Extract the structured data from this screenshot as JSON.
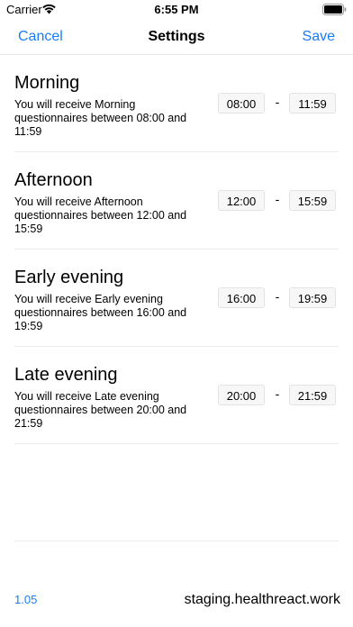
{
  "status_bar": {
    "carrier": "Carrier",
    "time": "6:55 PM",
    "icons": [
      "wifi-icon",
      "battery-icon"
    ]
  },
  "nav": {
    "cancel_label": "Cancel",
    "title": "Settings",
    "save_label": "Save",
    "accent_color": "#1a7cf5"
  },
  "sections": [
    {
      "title": "Morning",
      "description": "You will receive Morning questionnaires between 08:00 and 11:59",
      "start": "08:00",
      "end": "11:59"
    },
    {
      "title": "Afternoon",
      "description": "You will receive Afternoon questionnaires between 12:00 and 15:59",
      "start": "12:00",
      "end": "15:59"
    },
    {
      "title": "Early evening",
      "description": "You will receive Early evening questionnaires between 16:00 and 19:59",
      "start": "16:00",
      "end": "19:59"
    },
    {
      "title": "Late evening",
      "description": "You will receive Late evening questionnaires between 20:00 and 21:59",
      "start": "20:00",
      "end": "21:59"
    }
  ],
  "separator": "-",
  "footer": {
    "version": "1.05",
    "domain": "staging.healthreact.work"
  }
}
